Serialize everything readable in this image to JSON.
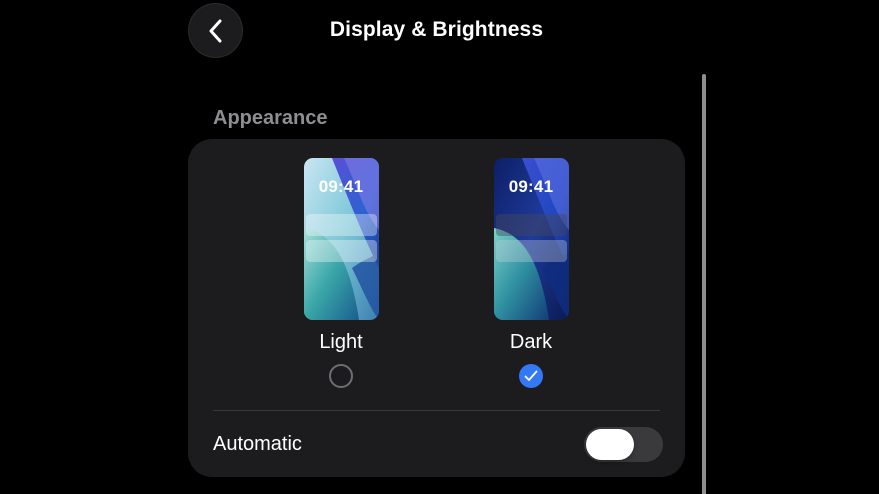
{
  "header": {
    "title": "Display & Brightness",
    "back_icon": "chevron-left-icon"
  },
  "appearance": {
    "section_title": "Appearance",
    "options": [
      {
        "label": "Light",
        "time": "09:41",
        "selected": false
      },
      {
        "label": "Dark",
        "time": "09:41",
        "selected": true
      }
    ],
    "check_icon": "checkmark-icon"
  },
  "automatic": {
    "label": "Automatic",
    "enabled": false
  },
  "colors": {
    "background": "#000000",
    "card": "#1c1c1e",
    "accent": "#3478f6",
    "secondary_text": "#8d8d92"
  }
}
